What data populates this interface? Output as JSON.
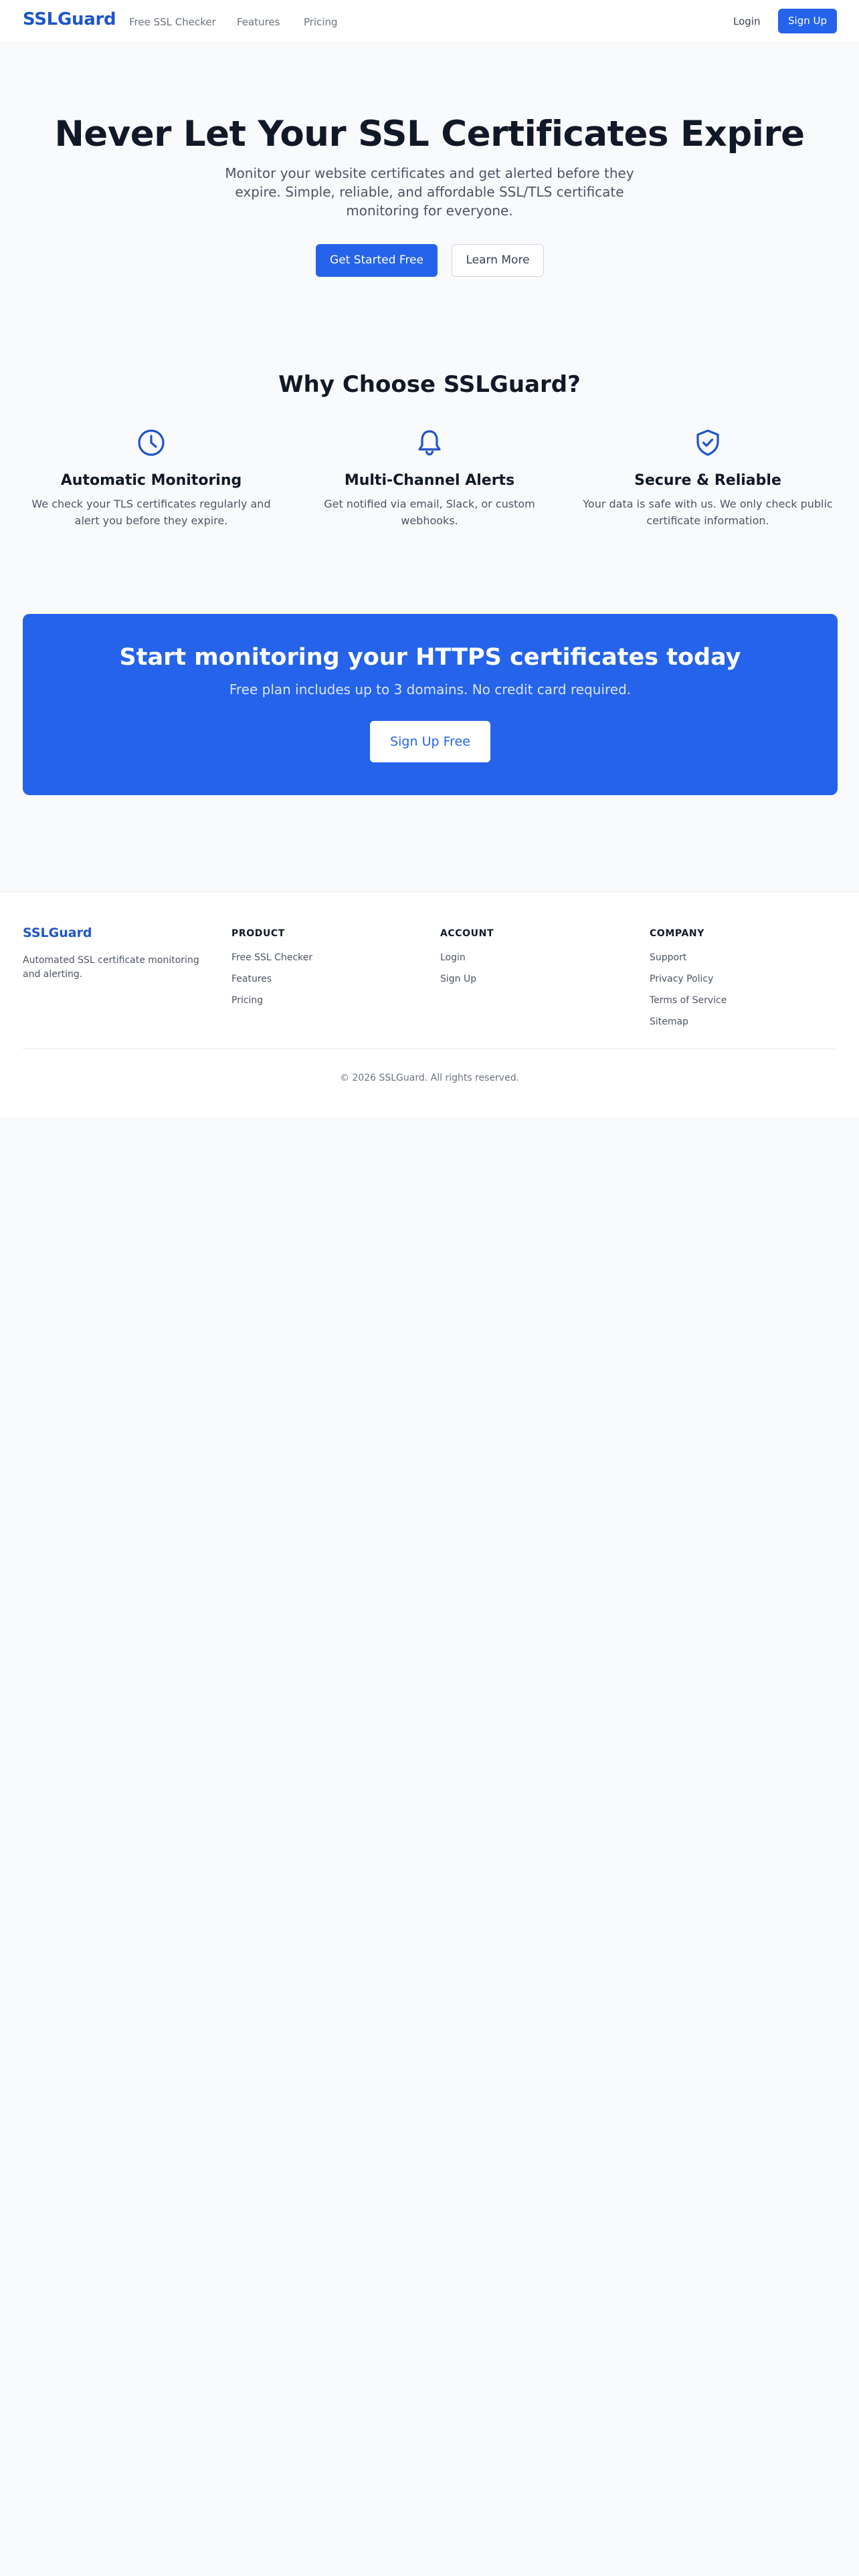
{
  "nav": {
    "brand": "SSLGuard",
    "links": [
      "Free SSL Checker",
      "Features",
      "Pricing"
    ],
    "login": "Login",
    "signup": "Sign Up"
  },
  "hero": {
    "title": "Never Let Your SSL Certificates Expire",
    "subtitle": "Monitor your website certificates and get alerted before they expire. Simple, reliable, and affordable SSL/TLS certificate monitoring for everyone.",
    "primary_cta": "Get Started Free",
    "secondary_cta": "Learn More"
  },
  "why": {
    "title": "Why Choose SSLGuard?",
    "features": [
      {
        "icon": "clock-icon",
        "title": "Automatic Monitoring",
        "description": "We check your TLS certificates regularly and alert you before they expire."
      },
      {
        "icon": "bell-icon",
        "title": "Multi-Channel Alerts",
        "description": "Get notified via email, Slack, or custom webhooks."
      },
      {
        "icon": "shield-check-icon",
        "title": "Secure & Reliable",
        "description": "Your data is safe with us. We only check public certificate information."
      }
    ]
  },
  "cta": {
    "title": "Start monitoring your HTTPS certificates today",
    "subtitle": "Free plan includes up to 3 domains. No credit card required.",
    "button": "Sign Up Free"
  },
  "footer": {
    "brand": "SSLGuard",
    "tagline": "Automated SSL certificate monitoring and alerting.",
    "columns": [
      {
        "heading": "PRODUCT",
        "links": [
          "Free SSL Checker",
          "Features",
          "Pricing"
        ]
      },
      {
        "heading": "ACCOUNT",
        "links": [
          "Login",
          "Sign Up"
        ]
      },
      {
        "heading": "COMPANY",
        "links": [
          "Support",
          "Privacy Policy",
          "Terms of Service",
          "Sitemap"
        ]
      }
    ],
    "copyright": "© 2026 SSLGuard. All rights reserved."
  },
  "colors": {
    "brand": "#1e55c8",
    "primary": "#2563eb",
    "background": "#f9fafb",
    "heading": "#111827",
    "body_text": "#4b5563"
  }
}
